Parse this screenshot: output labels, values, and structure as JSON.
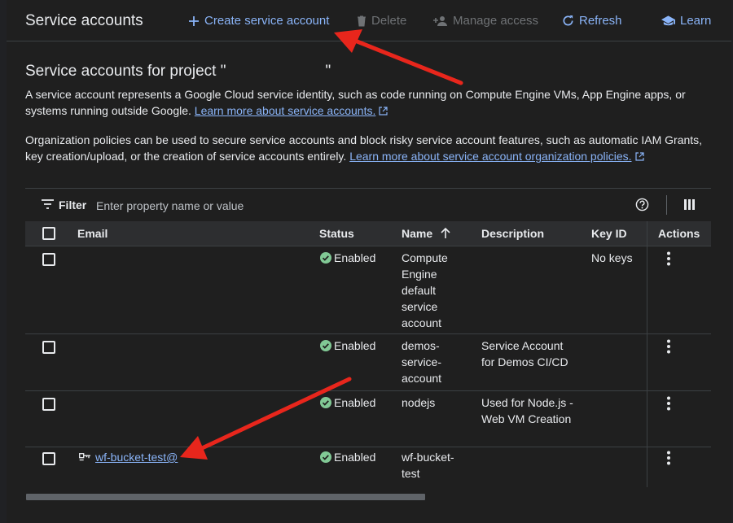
{
  "toolbar": {
    "title": "Service accounts",
    "create_label": "Create service account",
    "delete_label": "Delete",
    "manage_access_label": "Manage access",
    "refresh_label": "Refresh",
    "learn_label": "Learn"
  },
  "main": {
    "heading_prefix": "Service accounts for project \"",
    "heading_suffix": "\"",
    "intro_text": "A service account represents a Google Cloud service identity, such as code running on Compute Engine VMs, App Engine apps, or systems running outside Google.",
    "intro_link": "Learn more about service accounts.",
    "org_text": "Organization policies can be used to secure service accounts and block risky service account features, such as automatic IAM Grants, key creation/upload, or the creation of service accounts entirely.",
    "org_link": "Learn more about service account organization policies."
  },
  "filter": {
    "label": "Filter",
    "placeholder": "Enter property name or value"
  },
  "table": {
    "columns": [
      "Email",
      "Status",
      "Name",
      "Description",
      "Key ID",
      "Actions"
    ],
    "rows": [
      {
        "email": "",
        "status": "Enabled",
        "name": "Compute Engine default service account",
        "description": "",
        "key_id": "No keys"
      },
      {
        "email": "",
        "status": "Enabled",
        "name": "demos-service-account",
        "description": "Service Account for Demos CI/CD",
        "key_id": ""
      },
      {
        "email": "",
        "status": "Enabled",
        "name": "nodejs",
        "description": "Used for Node.js - Web VM Creation",
        "key_id": ""
      },
      {
        "email": "wf-bucket-test@",
        "status": "Enabled",
        "name": "wf-bucket-test",
        "description": "",
        "key_id": ""
      }
    ]
  },
  "colors": {
    "accent": "#8ab4f8",
    "status_green": "#81c995",
    "arrow_red": "#e8261c",
    "background": "#1f1f1f"
  },
  "icons": [
    "plus-icon",
    "trash-icon",
    "person-add-icon",
    "refresh-icon",
    "school-icon",
    "external-link-icon",
    "filter-icon",
    "help-icon",
    "columns-icon",
    "check-circle-icon",
    "more-vert-icon",
    "arrow-up-icon",
    "key-icon"
  ]
}
